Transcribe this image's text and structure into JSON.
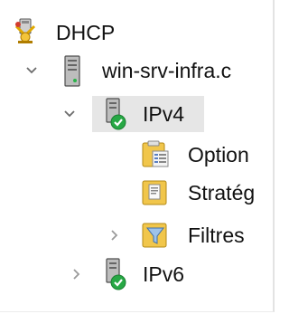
{
  "tree": {
    "root": {
      "label": "DHCP",
      "icon": "dhcp-server-icon"
    },
    "server": {
      "label": "win-srv-infra.c",
      "icon": "server-tower-icon",
      "expanded": true
    },
    "ipv4": {
      "label": "IPv4",
      "icon": "ipv4-scope-icon",
      "expanded": true,
      "selected": true
    },
    "options": {
      "label": "Option",
      "icon": "server-options-icon"
    },
    "policies": {
      "label": "Stratég",
      "icon": "policies-icon"
    },
    "filters": {
      "label": "Filtres",
      "icon": "filter-funnel-icon",
      "expanded": false
    },
    "ipv6": {
      "label": "IPv6",
      "icon": "ipv6-scope-icon",
      "expanded": false
    }
  },
  "colors": {
    "selection": "#e6e6e6",
    "chevron": "#6b6b6b",
    "status_green": "#27a845",
    "folder_yellow": "#f1c64b"
  }
}
